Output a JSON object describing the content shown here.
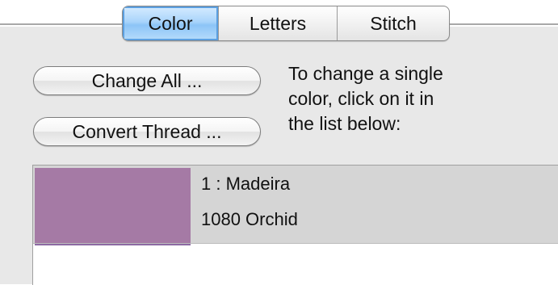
{
  "tabs": [
    {
      "label": "Color",
      "selected": true
    },
    {
      "label": "Letters",
      "selected": false
    },
    {
      "label": "Stitch",
      "selected": false
    }
  ],
  "buttons": {
    "change_all": "Change All ...",
    "convert_thread": "Convert Thread ..."
  },
  "help_text": [
    "To change a single",
    "color, click on it in",
    "the list below:"
  ],
  "thread_list": [
    {
      "line1": "1 : Madeira",
      "line2": "1080 Orchid",
      "swatch_color": "#a57aa5"
    }
  ],
  "colors": {
    "tab_selected": "#a9d4fb",
    "row_background": "#d5d5d5",
    "swatch": "#a57aa5"
  }
}
